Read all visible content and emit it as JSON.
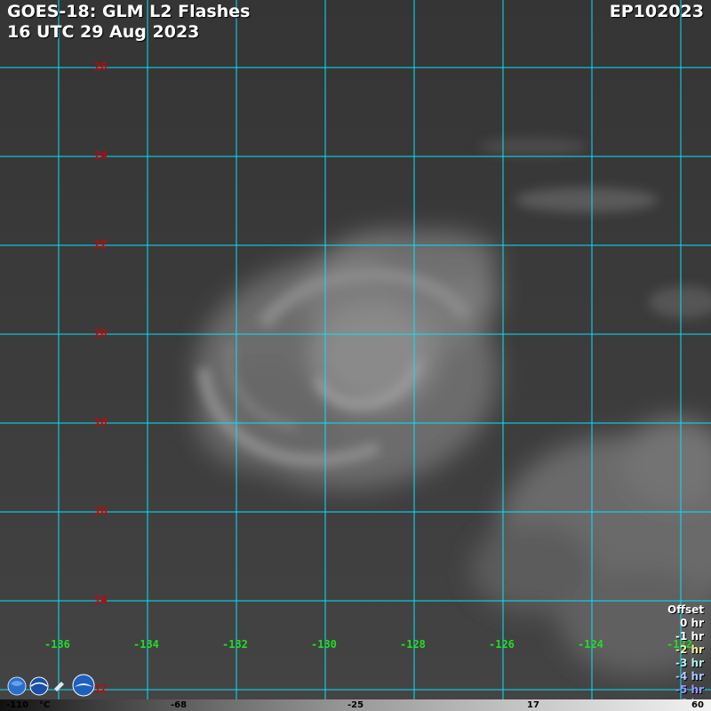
{
  "header": {
    "title": "GOES-18: GLM L2 Flashes",
    "time": "16 UTC 29 Aug 2023",
    "storm_id": "EP102023"
  },
  "grid": {
    "latitudes": [
      "26",
      "24",
      "22",
      "20",
      "18",
      "16",
      "14",
      "12"
    ],
    "longitudes": [
      "-136",
      "-134",
      "-132",
      "-130",
      "-128",
      "-126",
      "-124",
      "-122"
    ],
    "line_color": "#00e5ff",
    "lat_label_color": "#d00000",
    "lon_label_color": "#22dd22"
  },
  "legend": {
    "title": "Offset",
    "items": [
      {
        "label": "0 hr",
        "color": "#ffffff"
      },
      {
        "label": "-1 hr",
        "color": "#ffffff"
      },
      {
        "label": "-2 hr",
        "color": "#f0f0a0"
      },
      {
        "label": "-3 hr",
        "color": "#b8f0f0"
      },
      {
        "label": "-4 hr",
        "color": "#a8c8ff"
      },
      {
        "label": "-5 hr",
        "color": "#9999ff"
      },
      {
        "label": "-6 hr",
        "color": "#b07ad8"
      }
    ]
  },
  "colorbar": {
    "ticks": [
      "-110",
      "°C",
      "-68",
      "-25",
      "17",
      "60"
    ]
  }
}
